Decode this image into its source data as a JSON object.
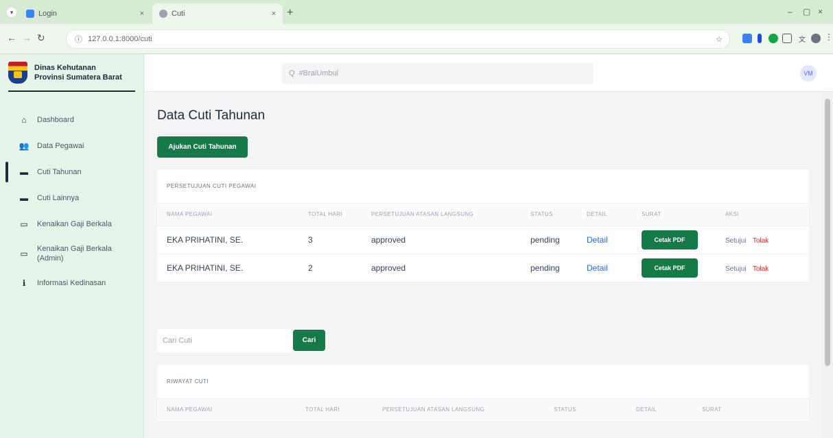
{
  "browser": {
    "tabs": [
      {
        "title": "Login",
        "active": false
      },
      {
        "title": "Cuti",
        "active": true
      }
    ],
    "new_tab": "+",
    "url": "127.0.0.1:8000/cuti",
    "tab_close": "×",
    "window_controls": [
      "–",
      "▢",
      "×"
    ]
  },
  "sidebar": {
    "brand_line1": "Dinas Kehutanan",
    "brand_line2": "Provinsi Sumatera Barat",
    "items": [
      {
        "label": "Dashboard",
        "icon": "home-icon",
        "glyph": "⌂"
      },
      {
        "label": "Data Pegawai",
        "icon": "users-icon",
        "glyph": "👥"
      },
      {
        "label": "Cuti Tahunan",
        "icon": "folder-icon",
        "glyph": "▬"
      },
      {
        "label": "Cuti Lainnya",
        "icon": "folder-icon",
        "glyph": "▬"
      },
      {
        "label": "Kenaikan Gaji Berkala",
        "icon": "card-icon",
        "glyph": "▭"
      },
      {
        "label": "Kenaikan Gaji Berkala (Admin)",
        "icon": "card-icon",
        "glyph": "▭"
      },
      {
        "label": "Informasi Kedinasan",
        "icon": "info-icon",
        "glyph": "ℹ"
      }
    ]
  },
  "topbar": {
    "search_placeholder": "#BraiUmbul",
    "search_icon": "Q",
    "avatar_text": "VM"
  },
  "main": {
    "title": "Data Cuti Tahunan",
    "ajukan_button": "Ajukan Cuti Tahunan",
    "approval_card": {
      "heading": "PERSETUJUAN CUTI PEGAWAI",
      "columns": [
        "NAMA PEGAWAI",
        "TOTAL HARI",
        "PERSETUJUAN ATASAN LANGSUNG",
        "STATUS",
        "DETAIL",
        "SURAT",
        "AKSI"
      ],
      "rows": [
        {
          "nama": "EKA PRIHATINI, SE.",
          "total": "3",
          "persetujuan": "approved",
          "status": "pending",
          "detail": "Detail",
          "surat": "Cetak PDF",
          "setuju": "Setujui",
          "tolak": "Tolak"
        },
        {
          "nama": "EKA PRIHATINI, SE.",
          "total": "2",
          "persetujuan": "approved",
          "status": "pending",
          "detail": "Detail",
          "surat": "Cetak PDF",
          "setuju": "Setujui",
          "tolak": "Tolak"
        }
      ]
    },
    "search": {
      "placeholder": "Cari Cuti",
      "button": "Cari"
    },
    "history_card": {
      "heading": "RIWAYAT CUTI",
      "columns": [
        "NAMA PEGAWAI",
        "TOTAL HARI",
        "PERSETUJUAN ATASAN LANGSUNG",
        "STATUS",
        "DETAIL",
        "SURAT"
      ]
    }
  },
  "colors": {
    "accent": "#157a47",
    "danger": "#dc2626",
    "link": "#2563eb",
    "sidebar": "#e6f4ea"
  }
}
